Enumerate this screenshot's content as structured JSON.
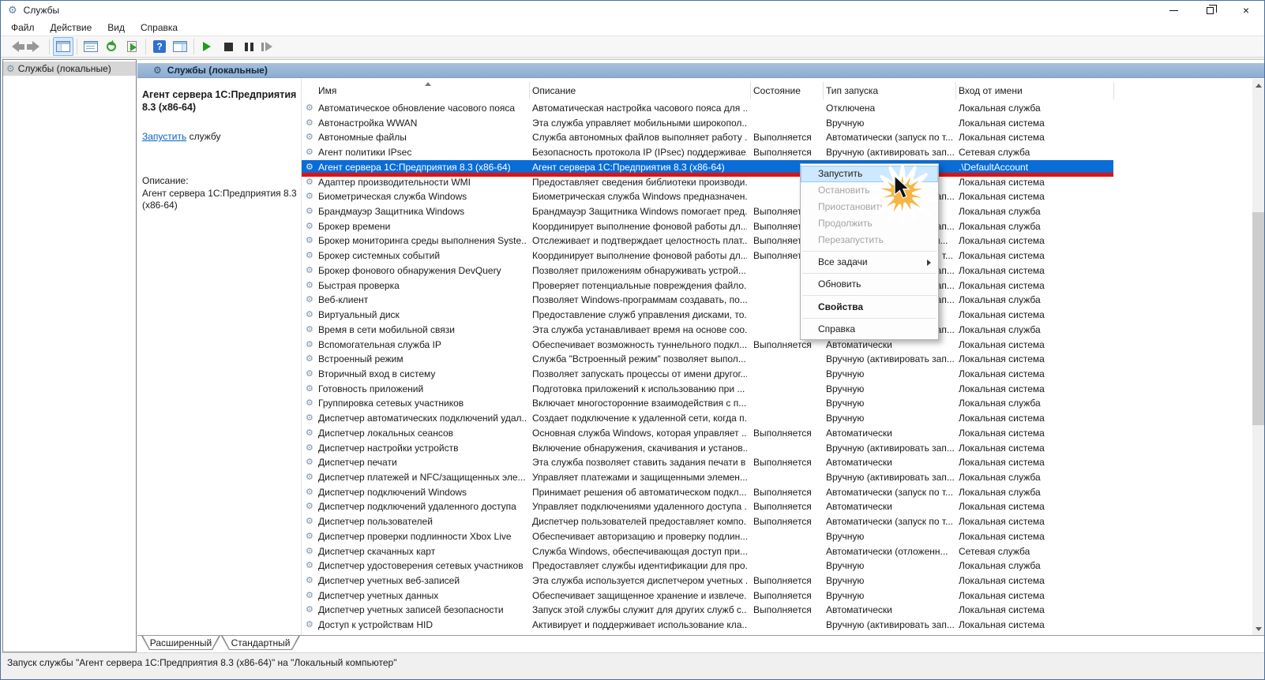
{
  "window": {
    "title": "Службы",
    "controls": {
      "minimize": "minimize",
      "restore": "restore-down",
      "close": "close"
    }
  },
  "menubar": {
    "items": [
      {
        "label": "Файл"
      },
      {
        "label": "Действие"
      },
      {
        "label": "Вид"
      },
      {
        "label": "Справка"
      }
    ]
  },
  "toolbar": {
    "buttons": [
      "back",
      "forward",
      "show-console-tree",
      "properties",
      "refresh",
      "export-list",
      "help",
      "show-action-pane",
      "start-service",
      "stop-service",
      "pause-service",
      "restart-service"
    ],
    "active_button": "show-console-tree"
  },
  "tree": {
    "root_label": "Службы (локальные)"
  },
  "result_header": "Службы (локальные)",
  "extended": {
    "service_title": "Агент сервера 1С:Предприятия 8.3 (x86-64)",
    "action_link": "Запустить",
    "action_suffix": " службу",
    "description_label": "Описание:",
    "description": "Агент сервера 1С:Предприятия 8.3 (x86-64)"
  },
  "table": {
    "columns": [
      "Имя",
      "Описание",
      "Состояние",
      "Тип запуска",
      "Вход от имени"
    ],
    "sorted_column": "Имя",
    "rows": [
      {
        "name": "Автоматическое обновление часового пояса",
        "description": "Автоматическая настройка часового пояса для ...",
        "status": "",
        "startup_type": "Отключена",
        "logon_as": "Локальная служба",
        "selected": false
      },
      {
        "name": "Автонастройка WWAN",
        "description": "Эта служба управляет мобильными широкопол...",
        "status": "",
        "startup_type": "Вручную",
        "logon_as": "Локальная система",
        "selected": false
      },
      {
        "name": "Автономные файлы",
        "description": "Служба автономных файлов выполняет работу ...",
        "status": "Выполняется",
        "startup_type": "Автоматически (запуск по т...",
        "logon_as": "Локальная система",
        "selected": false
      },
      {
        "name": "Агент политики IPsec",
        "description": "Безопасность протокола IP (IPsec) поддерживае...",
        "status": "Выполняется",
        "startup_type": "Вручную (активировать зап...",
        "logon_as": "Сетевая служба",
        "selected": false
      },
      {
        "name": "Агент сервера 1С:Предприятия 8.3 (x86-64)",
        "description": "Агент сервера 1С:Предприятия 8.3 (x86-64)",
        "status": "",
        "startup_type": "",
        "logon_as": ".\\DefaultAccount",
        "selected": true
      },
      {
        "name": "Адаптер производительности WMI",
        "description": "Предоставляет сведения библиотеки производи...",
        "status": "",
        "startup_type": "",
        "logon_as": "Локальная система",
        "selected": false
      },
      {
        "name": "Биометрическая служба Windows",
        "description": "Биометрическая служба Windows предназначен...",
        "status": "",
        "startup_type": "Вручную (активировать зап...",
        "logon_as": "Локальная система",
        "selected": false
      },
      {
        "name": "Брандмауэр Защитника Windows",
        "description": "Брандмауэр Защитника Windows помогает пред...",
        "status": "Выполняется",
        "startup_type": "",
        "logon_as": "Локальная служба",
        "selected": false
      },
      {
        "name": "Брокер времени",
        "description": "Координирует выполнение фоновой работы дл...",
        "status": "Выполняется",
        "startup_type": "Вручную (активировать зап...",
        "logon_as": "Локальная служба",
        "selected": false
      },
      {
        "name": "Брокер мониторинга среды выполнения Syste...",
        "description": "Отслеживает и подтверждает целостность плат...",
        "status": "Выполняется",
        "startup_type": "Автоматически (отложенн...",
        "logon_as": "Локальная система",
        "selected": false
      },
      {
        "name": "Брокер системных событий",
        "description": "Координирует выполнение фоновой работы дл...",
        "status": "Выполняется",
        "startup_type": "Автоматически (запуск по т...",
        "logon_as": "Локальная система",
        "selected": false
      },
      {
        "name": "Брокер фонового обнаружения DevQuery",
        "description": "Позволяет приложениям обнаруживать устрой...",
        "status": "",
        "startup_type": "Вручную (активировать зап...",
        "logon_as": "Локальная система",
        "selected": false
      },
      {
        "name": "Быстрая проверка",
        "description": "Проверяет потенциальные повреждения файло...",
        "status": "",
        "startup_type": "Вручную (активировать зап...",
        "logon_as": "Локальная система",
        "selected": false
      },
      {
        "name": "Веб-клиент",
        "description": "Позволяет Windows-программам создавать, по...",
        "status": "",
        "startup_type": "Вручную (активировать зап...",
        "logon_as": "Локальная служба",
        "selected": false
      },
      {
        "name": "Виртуальный диск",
        "description": "Предоставление служб управления дисками, то...",
        "status": "",
        "startup_type": "",
        "logon_as": "Локальная система",
        "selected": false
      },
      {
        "name": "Время в сети мобильной связи",
        "description": "Эта служба устанавливает время на основе соо...",
        "status": "",
        "startup_type": "Вручную (активировать зап...",
        "logon_as": "Локальная служба",
        "selected": false
      },
      {
        "name": "Вспомогательная служба IP",
        "description": "Обеспечивает возможность туннельного подкл...",
        "status": "Выполняется",
        "startup_type": "Автоматически",
        "logon_as": "Локальная система",
        "selected": false
      },
      {
        "name": "Встроенный режим",
        "description": "Служба \"Встроенный режим\" позволяет выпол...",
        "status": "",
        "startup_type": "Вручную (активировать зап...",
        "logon_as": "Локальная система",
        "selected": false
      },
      {
        "name": "Вторичный вход в систему",
        "description": "Позволяет запускать процессы от имени другог...",
        "status": "",
        "startup_type": "Вручную",
        "logon_as": "Локальная система",
        "selected": false
      },
      {
        "name": "Готовность приложений",
        "description": "Подготовка приложений к использованию при ...",
        "status": "",
        "startup_type": "Вручную",
        "logon_as": "Локальная система",
        "selected": false
      },
      {
        "name": "Группировка сетевых участников",
        "description": "Включает многосторонние взаимодействия с п...",
        "status": "",
        "startup_type": "Вручную",
        "logon_as": "Локальная служба",
        "selected": false
      },
      {
        "name": "Диспетчер автоматических подключений удал...",
        "description": "Создает подключение к удаленной сети, когда п...",
        "status": "",
        "startup_type": "Вручную",
        "logon_as": "Локальная система",
        "selected": false
      },
      {
        "name": "Диспетчер локальных сеансов",
        "description": "Основная служба Windows, которая управляет ...",
        "status": "Выполняется",
        "startup_type": "Автоматически",
        "logon_as": "Локальная система",
        "selected": false
      },
      {
        "name": "Диспетчер настройки устройств",
        "description": "Включение обнаружения, скачивания и установ...",
        "status": "",
        "startup_type": "Вручную (активировать зап...",
        "logon_as": "Локальная система",
        "selected": false
      },
      {
        "name": "Диспетчер печати",
        "description": "Эта служба позволяет ставить задания печати в ...",
        "status": "Выполняется",
        "startup_type": "Автоматически",
        "logon_as": "Локальная система",
        "selected": false
      },
      {
        "name": "Диспетчер платежей и NFC/защищенных эле...",
        "description": "Управляет платежами и защищенными элемен...",
        "status": "",
        "startup_type": "Вручную (активировать зап...",
        "logon_as": "Локальная служба",
        "selected": false
      },
      {
        "name": "Диспетчер подключений Windows",
        "description": "Принимает решения об автоматическом подкл...",
        "status": "Выполняется",
        "startup_type": "Автоматически (запуск по т...",
        "logon_as": "Локальная служба",
        "selected": false
      },
      {
        "name": "Диспетчер подключений удаленного доступа",
        "description": "Управляет подключениями удаленного доступа ...",
        "status": "Выполняется",
        "startup_type": "Автоматически",
        "logon_as": "Локальная система",
        "selected": false
      },
      {
        "name": "Диспетчер пользователей",
        "description": "Диспетчер пользователей предоставляет компо...",
        "status": "Выполняется",
        "startup_type": "Автоматически (запуск по т...",
        "logon_as": "Локальная система",
        "selected": false
      },
      {
        "name": "Диспетчер проверки подлинности Xbox Live",
        "description": "Обеспечивает авторизацию и проверку подлин...",
        "status": "",
        "startup_type": "Вручную",
        "logon_as": "Локальная система",
        "selected": false
      },
      {
        "name": "Диспетчер скачанных карт",
        "description": "Служба Windows, обеспечивающая доступ при...",
        "status": "",
        "startup_type": "Автоматически (отложенн...",
        "logon_as": "Сетевая служба",
        "selected": false
      },
      {
        "name": "Диспетчер удостоверения сетевых участников",
        "description": "Предоставляет службы идентификации для про...",
        "status": "",
        "startup_type": "Вручную",
        "logon_as": "Локальная служба",
        "selected": false
      },
      {
        "name": "Диспетчер учетных веб-записей",
        "description": "Эта служба используется диспетчером учетных ...",
        "status": "Выполняется",
        "startup_type": "Вручную",
        "logon_as": "Локальная система",
        "selected": false
      },
      {
        "name": "Диспетчер учетных данных",
        "description": "Обеспечивает защищенное хранение и извлече...",
        "status": "Выполняется",
        "startup_type": "Вручную",
        "logon_as": "Локальная система",
        "selected": false
      },
      {
        "name": "Диспетчер учетных записей безопасности",
        "description": "Запуск этой службы служит для других служб с...",
        "status": "Выполняется",
        "startup_type": "Автоматически",
        "logon_as": "Локальная система",
        "selected": false
      },
      {
        "name": "Доступ к устройствам HID",
        "description": "Активирует и поддерживает использование кла...",
        "status": "",
        "startup_type": "Вручную (активировать зап...",
        "logon_as": "Локальная система",
        "selected": false
      },
      {
        "name": "",
        "description": "",
        "status": "",
        "startup_type": "",
        "logon_as": "",
        "selected": false,
        "partial": true
      }
    ]
  },
  "context_menu": {
    "items": [
      {
        "label": "Запустить",
        "enabled": true,
        "highlighted": true
      },
      {
        "label": "Остановить",
        "enabled": false
      },
      {
        "label": "Приостановить",
        "enabled": false
      },
      {
        "label": "Продолжить",
        "enabled": false
      },
      {
        "label": "Перезапустить",
        "enabled": false
      },
      {
        "separator": true
      },
      {
        "label": "Все задачи",
        "enabled": true,
        "submenu": true
      },
      {
        "separator": true
      },
      {
        "label": "Обновить",
        "enabled": true
      },
      {
        "separator": true
      },
      {
        "label": "Свойства",
        "enabled": true,
        "bold": true
      },
      {
        "separator": true
      },
      {
        "label": "Справка",
        "enabled": true
      }
    ]
  },
  "tabs": [
    {
      "label": "Расширенный",
      "active": true
    },
    {
      "label": "Стандартный",
      "active": false
    }
  ],
  "status_bar": {
    "text": "Запуск службы \"Агент сервера 1С:Предприятия 8.3 (x86-64)\" на \"Локальный компьютер\""
  },
  "colors": {
    "selection": "#0a6cd6",
    "annotation_line": "#e31010",
    "starburst": "#f6b545",
    "band_top": "#a9c0dc",
    "band_bottom": "#8badd1",
    "menu_highlight": "#cde8ff"
  }
}
